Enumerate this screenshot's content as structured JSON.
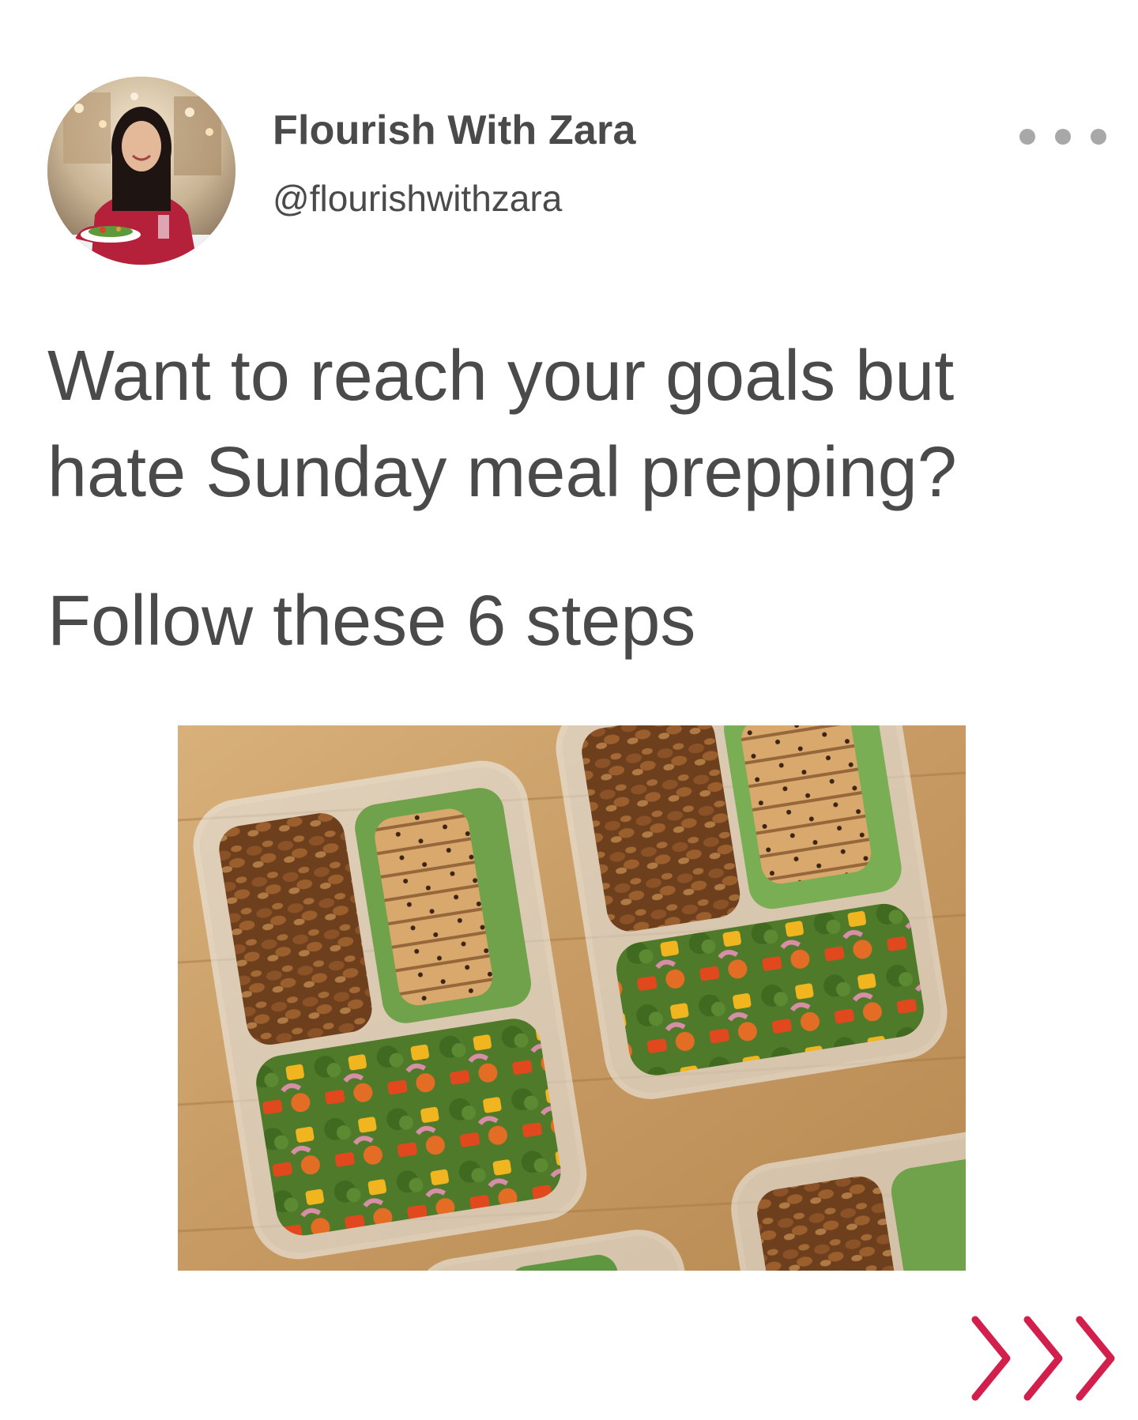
{
  "profile": {
    "name": "Flourish With Zara",
    "handle": "@flourishwithzara"
  },
  "post": {
    "headline": "Want to reach your goals but hate Sunday meal prepping?",
    "subline": "Follow these 6 steps"
  },
  "icons": {
    "more": "more-horizontal-icon",
    "next": "triple-chevron-right-icon"
  },
  "colors": {
    "text": "#4a4a4a",
    "dots": "#a8a8a8",
    "accent": "#d21f4c"
  }
}
